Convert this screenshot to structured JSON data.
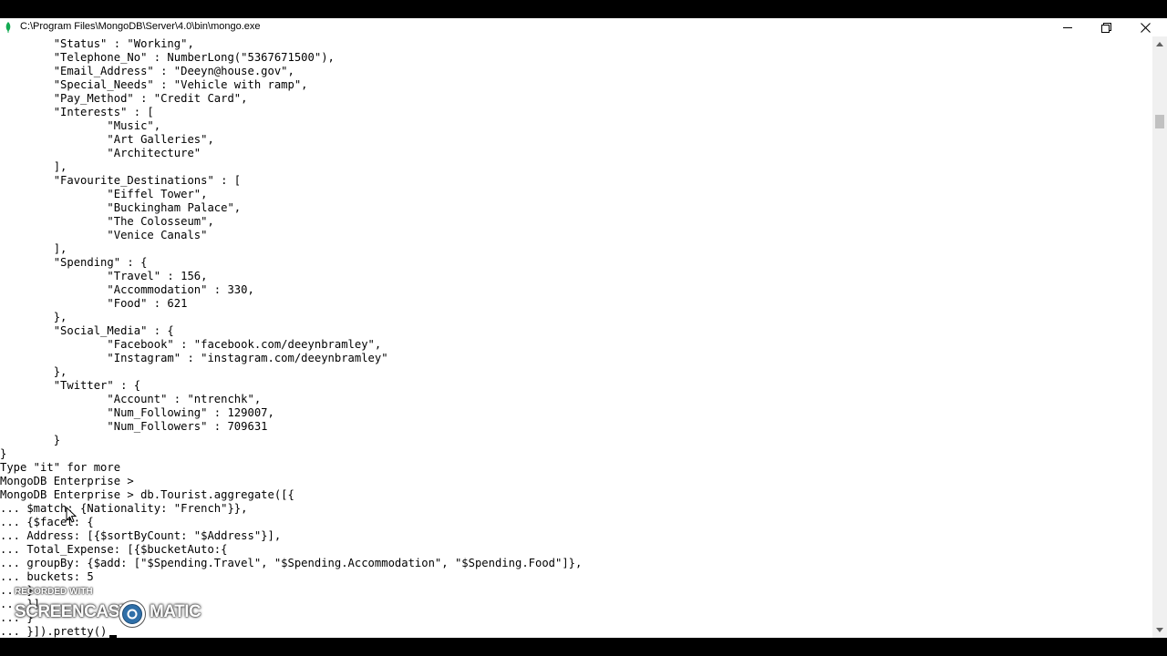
{
  "window": {
    "title": "C:\\Program Files\\MongoDB\\Server\\4.0\\bin\\mongo.exe",
    "icon": "mongodb-leaf-icon"
  },
  "controls": {
    "minimize": "minimize-icon",
    "maximize": "restore-icon",
    "close": "close-icon"
  },
  "console": {
    "lines": [
      "        \"Status\" : \"Working\",",
      "        \"Telephone_No\" : NumberLong(\"5367671500\"),",
      "        \"Email_Address\" : \"Deeyn@house.gov\",",
      "        \"Special_Needs\" : \"Vehicle with ramp\",",
      "        \"Pay_Method\" : \"Credit Card\",",
      "        \"Interests\" : [",
      "                \"Music\",",
      "                \"Art Galleries\",",
      "                \"Architecture\"",
      "        ],",
      "        \"Favourite_Destinations\" : [",
      "                \"Eiffel Tower\",",
      "                \"Buckingham Palace\",",
      "                \"The Colosseum\",",
      "                \"Venice Canals\"",
      "        ],",
      "        \"Spending\" : {",
      "                \"Travel\" : 156,",
      "                \"Accommodation\" : 330,",
      "                \"Food\" : 621",
      "        },",
      "        \"Social_Media\" : {",
      "                \"Facebook\" : \"facebook.com/deeynbramley\",",
      "                \"Instagram\" : \"instagram.com/deeynbramley\"",
      "        },",
      "        \"Twitter\" : {",
      "                \"Account\" : \"ntrenchk\",",
      "                \"Num_Following\" : 129007,",
      "                \"Num_Followers\" : 709631",
      "        }",
      "}",
      "Type \"it\" for more",
      "MongoDB Enterprise >",
      "MongoDB Enterprise > db.Tourist.aggregate([{",
      "... $match: {Nationality: \"French\"}},",
      "... {$facet: {",
      "... Address: [{$sortByCount: \"$Address\"}],",
      "... Total_Expense: [{$bucketAuto:{",
      "... groupBy: {$add: [\"$Spending.Travel\", \"$Spending.Accommodation\", \"$Spending.Food\"]},",
      "... buckets: 5",
      "... }",
      "... }]",
      "... }",
      "... }]).pretty()"
    ]
  },
  "watermark": {
    "recorded_with": "RECORDED WITH",
    "brand_left": "SCREENCAST",
    "brand_right": "MATIC"
  }
}
